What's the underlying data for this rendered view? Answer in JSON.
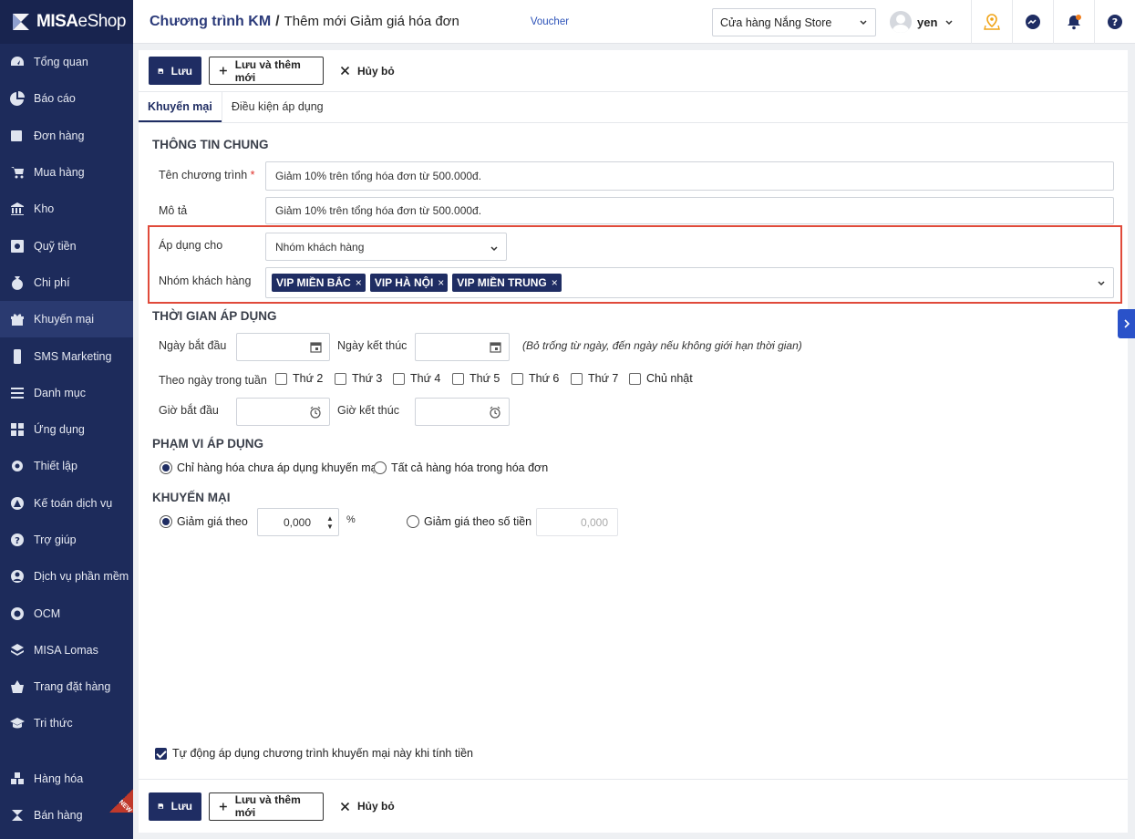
{
  "app": {
    "logo_brand": "MISA",
    "logo_product": "eShop"
  },
  "sidebar": {
    "items": [
      {
        "label": "Tổng quan",
        "icon": "dashboard-icon"
      },
      {
        "label": "Báo cáo",
        "icon": "pie-chart-icon"
      },
      {
        "label": "Đơn hàng",
        "icon": "delivery-truck-icon"
      },
      {
        "label": "Mua hàng",
        "icon": "cart-icon"
      },
      {
        "label": "Kho",
        "icon": "warehouse-icon"
      },
      {
        "label": "Quỹ tiền",
        "icon": "safe-icon"
      },
      {
        "label": "Chi phí",
        "icon": "money-bag-icon"
      },
      {
        "label": "Khuyến mại",
        "icon": "gift-icon"
      },
      {
        "label": "SMS Marketing",
        "icon": "phone-icon"
      },
      {
        "label": "Danh mục",
        "icon": "list-icon"
      },
      {
        "label": "Ứng dụng",
        "icon": "apps-icon"
      },
      {
        "label": "Thiết lập",
        "icon": "gear-icon"
      },
      {
        "label": "Kế toán dịch vụ",
        "icon": "accounting-icon"
      },
      {
        "label": "Trợ giúp",
        "icon": "help-icon"
      },
      {
        "label": "Dịch vụ phần mềm",
        "icon": "user-service-icon"
      },
      {
        "label": "OCM",
        "icon": "ocm-icon"
      },
      {
        "label": "MISA Lomas",
        "icon": "layers-icon"
      },
      {
        "label": "Trang đặt hàng",
        "icon": "basket-icon"
      },
      {
        "label": "Tri thức",
        "icon": "graduation-cap-icon"
      }
    ],
    "bottom_items": [
      {
        "label": "Hàng hóa",
        "icon": "boxes-icon"
      },
      {
        "label": "Bán hàng",
        "icon": "misa-logo-icon"
      }
    ],
    "new_badge": "NEW",
    "accent_color": "#1d2b5b"
  },
  "header": {
    "breadcrumb_root": "Chương trình KM",
    "breadcrumb_sep": "/",
    "breadcrumb_current": "Thêm mới Giảm giá hóa đơn",
    "voucher_link": "Voucher",
    "store_select": "Cửa hàng Nắng Store",
    "user_name": "yen"
  },
  "toolbar": {
    "save_label": "Lưu",
    "save_add_label": "Lưu và thêm mới",
    "cancel_label": "Hủy bỏ"
  },
  "tabs": [
    {
      "label": "Khuyến mại",
      "active": true
    },
    {
      "label": "Điều kiện áp dụng",
      "active": false
    }
  ],
  "general": {
    "title": "THÔNG TIN CHUNG",
    "program_name_label": "Tên chương trình",
    "required_mark": "*",
    "program_name_value": "Giảm 10% trên tổng hóa đơn từ 500.000đ.",
    "description_label": "Mô tả",
    "description_value": "Giảm 10% trên tổng hóa đơn từ 500.000đ.",
    "apply_for_label": "Áp dụng cho",
    "apply_for_value": "Nhóm khách hàng",
    "customer_group_label": "Nhóm khách hàng",
    "customer_groups": [
      "VIP MIỀN BẮC",
      "VIP HÀ NỘI",
      "VIP MIỀN TRUNG"
    ],
    "chip_remove": "×"
  },
  "time": {
    "title": "THỜI GIAN ÁP DỤNG",
    "start_date_label": "Ngày bắt đầu",
    "end_date_label": "Ngày kết thúc",
    "date_hint": "(Bỏ trống từ ngày, đến ngày nếu không giới hạn thời gian)",
    "weekday_label": "Theo ngày trong tuần",
    "weekdays": [
      "Thứ 2",
      "Thứ 3",
      "Thứ 4",
      "Thứ 5",
      "Thứ 6",
      "Thứ 7",
      "Chủ nhật"
    ],
    "start_time_label": "Giờ bắt đầu",
    "end_time_label": "Giờ kết thúc"
  },
  "scope": {
    "title": "PHẠM VI ÁP DỤNG",
    "option_1": "Chỉ hàng hóa chưa áp dụng khuyến mại",
    "option_2": "Tất cả hàng hóa trong hóa đơn",
    "selected": 1
  },
  "promo": {
    "title": "KHUYẾN MẠI",
    "discount_percent_label": "Giảm giá theo",
    "discount_percent_value": "0,000",
    "percent_unit": "%",
    "discount_amount_label": "Giảm giá theo số tiền",
    "discount_amount_value": "0,000"
  },
  "auto_apply_label": "Tự động áp dụng chương trình khuyến mại này khi tính tiền"
}
